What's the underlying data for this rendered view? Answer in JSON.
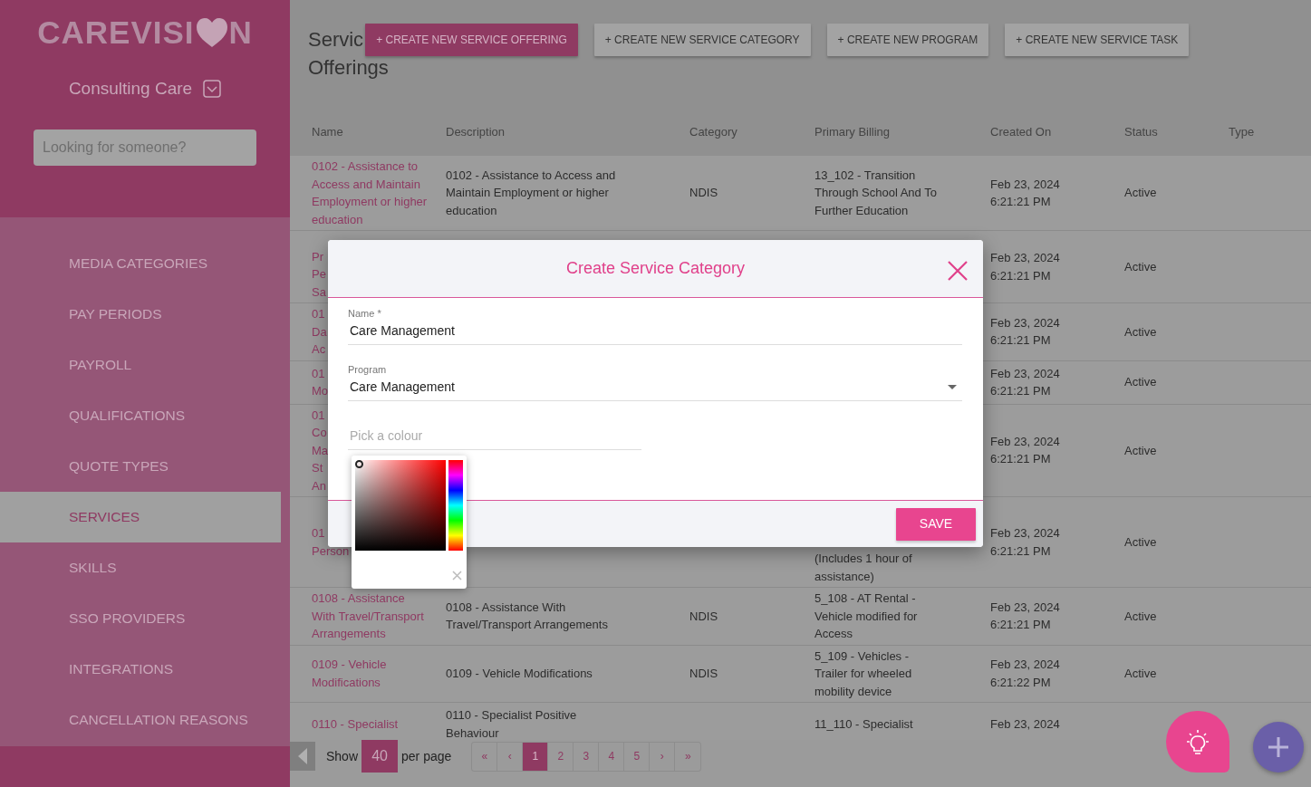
{
  "sidebar": {
    "logo": {
      "text_before_icon": "CAREVISI",
      "text_after_icon": "N"
    },
    "organisation": "Consulting Care",
    "search": {
      "placeholder": "Looking for someone?"
    },
    "items": [
      {
        "label": "MEDIA CATEGORIES",
        "selected": false
      },
      {
        "label": "PAY PERIODS",
        "selected": false
      },
      {
        "label": "PAYROLL",
        "selected": false
      },
      {
        "label": "QUALIFICATIONS",
        "selected": false
      },
      {
        "label": "QUOTE TYPES",
        "selected": false
      },
      {
        "label": "SERVICES",
        "selected": true
      },
      {
        "label": "SKILLS",
        "selected": false
      },
      {
        "label": "SSO PROVIDERS",
        "selected": false
      },
      {
        "label": "INTEGRATIONS",
        "selected": false
      },
      {
        "label": "CANCELLATION REASONS",
        "selected": false
      }
    ]
  },
  "page": {
    "title_lines": [
      "Servic",
      "Offerings"
    ],
    "actions": [
      {
        "label": "+ CREATE NEW SERVICE OFFERING",
        "kind": "primary"
      },
      {
        "label": "+ CREATE NEW SERVICE CATEGORY",
        "kind": "secondary"
      },
      {
        "label": "+ CREATE NEW PROGRAM",
        "kind": "secondary"
      },
      {
        "label": "+ CREATE NEW SERVICE TASK",
        "kind": "secondary"
      }
    ]
  },
  "table": {
    "columns": [
      "Name",
      "Description",
      "Category",
      "Primary Billing",
      "Created On",
      "Status",
      "Type"
    ],
    "rows": [
      {
        "name": "0102 - Assistance to Access and Maintain Employment or higher education",
        "description": "0102 - Assistance to Access and Maintain Employment or higher education",
        "category": "NDIS",
        "primary_billing": "13_102 - Transition Through School And To Further Education",
        "created_on": "Feb 23, 2024 6:21:21 PM",
        "status": "Active"
      },
      {
        "name": [
          "Pr",
          "Pe",
          "Sa"
        ],
        "created_on": "Feb 23, 2024 6:21:21 PM",
        "status": "Active"
      },
      {
        "name": [
          "01",
          "Da",
          "Ac"
        ],
        "created_on": "Feb 23, 2024 6:21:21 PM",
        "status": "Active"
      },
      {
        "name": [
          "01",
          "Mo"
        ],
        "created_on": "Feb 23, 2024 6:21:21 PM",
        "status": "Active"
      },
      {
        "name": [
          "01",
          "Co",
          "Ma",
          "St",
          "An"
        ],
        "created_on": "Feb 23, 2024 6:21:21 PM",
        "status": "Active"
      },
      {
        "name": [
          "01",
          "Person"
        ],
        "primary_billing": "(Includes 1 hour of assistance)",
        "created_on": "Feb 23, 2024 6:21:21 PM",
        "status": "Active"
      },
      {
        "name": "0108 - Assistance With Travel/Transport Arrangements",
        "description": "0108 - Assistance With Travel/Transport Arrangements",
        "category": "NDIS",
        "primary_billing": "5_108 - AT Rental - Vehicle modified for Access",
        "created_on": "Feb 23, 2024 6:21:21 PM",
        "status": "Active"
      },
      {
        "name": "0109 - Vehicle Modifications",
        "description": "0109 - Vehicle Modifications",
        "category": "NDIS",
        "primary_billing": "5_109 - Vehicles - Trailer for wheeled mobility device",
        "created_on": "Feb 23, 2024 6:21:22 PM",
        "status": "Active"
      },
      {
        "name": "0110 - Specialist",
        "description": "0110 - Specialist Positive Behaviour",
        "primary_billing": "11_110 - Specialist",
        "created_on": "Feb 23, 2024"
      }
    ]
  },
  "pagination": {
    "show_label": "Show",
    "page_size": "40",
    "per_page_label": "per page",
    "pages": [
      {
        "label": "«",
        "selected": false
      },
      {
        "label": "‹",
        "selected": false
      },
      {
        "label": "1",
        "selected": true
      },
      {
        "label": "2",
        "selected": false
      },
      {
        "label": "3",
        "selected": false
      },
      {
        "label": "4",
        "selected": false
      },
      {
        "label": "5",
        "selected": false
      },
      {
        "label": "›",
        "selected": false
      },
      {
        "label": "»",
        "selected": false
      }
    ]
  },
  "modal": {
    "title": "Create Service Category",
    "fields": [
      {
        "kind": "text",
        "label": "Name *",
        "value": "Care Management"
      },
      {
        "kind": "select",
        "label": "Program",
        "value": "Care Management"
      },
      {
        "kind": "color",
        "placeholder": "Pick a colour",
        "picker_open": true
      }
    ],
    "save_label": "SAVE"
  }
}
